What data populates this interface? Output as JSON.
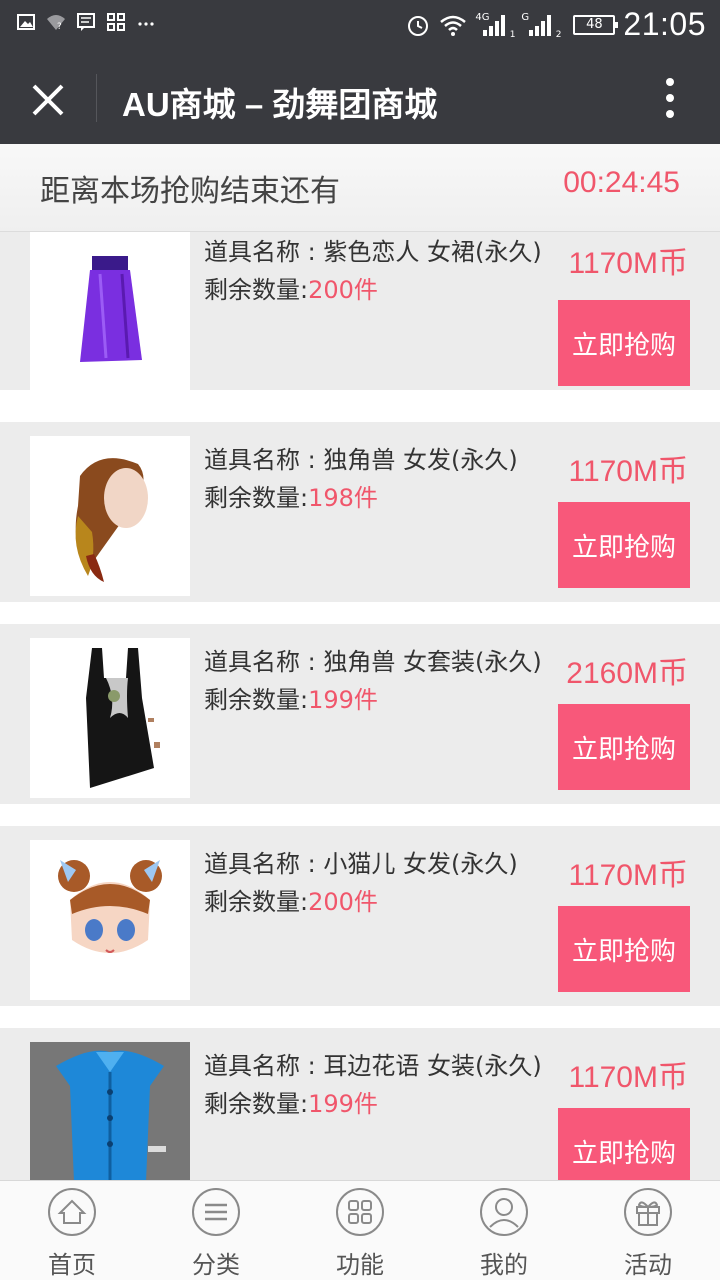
{
  "status_bar": {
    "left_icons": [
      "image-icon",
      "wifi-question-icon",
      "message-icon",
      "apps-icon",
      "more-dots-icon"
    ],
    "network_1": "4G",
    "network_2": "G",
    "sim_1": "1",
    "sim_2": "2",
    "battery": "48",
    "time": "21:05"
  },
  "header": {
    "title": "AU商城 – 劲舞团商城"
  },
  "countdown": {
    "label": "距离本场抢购结束还有",
    "time": "00:24:45"
  },
  "products": [
    {
      "name": "道具名称 : 紫色恋人 女裙(永久)",
      "price": "1170M币",
      "qty_label": "剩余数量:",
      "qty": "200件",
      "buy_label": "立即抢购",
      "image": "purple-skirt"
    },
    {
      "name": "道具名称 : 独角兽 女发(永久)",
      "price": "1170M币",
      "qty_label": "剩余数量:",
      "qty": "198件",
      "buy_label": "立即抢购",
      "image": "brown-hair"
    },
    {
      "name": "道具名称 : 独角兽 女套装(永久)",
      "price": "2160M币",
      "qty_label": "剩余数量:",
      "qty": "199件",
      "buy_label": "立即抢购",
      "image": "black-dress"
    },
    {
      "name": "道具名称 : 小猫儿 女发(永久)",
      "price": "1170M币",
      "qty_label": "剩余数量:",
      "qty": "200件",
      "buy_label": "立即抢购",
      "image": "cat-hair"
    },
    {
      "name": "道具名称 : 耳边花语 女装(永久)",
      "price": "1170M币",
      "qty_label": "剩余数量:",
      "qty": "199件",
      "buy_label": "立即抢购",
      "image": "blue-top"
    }
  ],
  "bottom_nav": [
    {
      "label": "首页",
      "icon": "home-icon"
    },
    {
      "label": "分类",
      "icon": "menu-icon"
    },
    {
      "label": "功能",
      "icon": "grid-icon"
    },
    {
      "label": "我的",
      "icon": "user-icon"
    },
    {
      "label": "活动",
      "icon": "gift-icon"
    }
  ],
  "colors": {
    "accent": "#f0566b",
    "button": "#f8587a",
    "header_bg": "#393a3f"
  }
}
